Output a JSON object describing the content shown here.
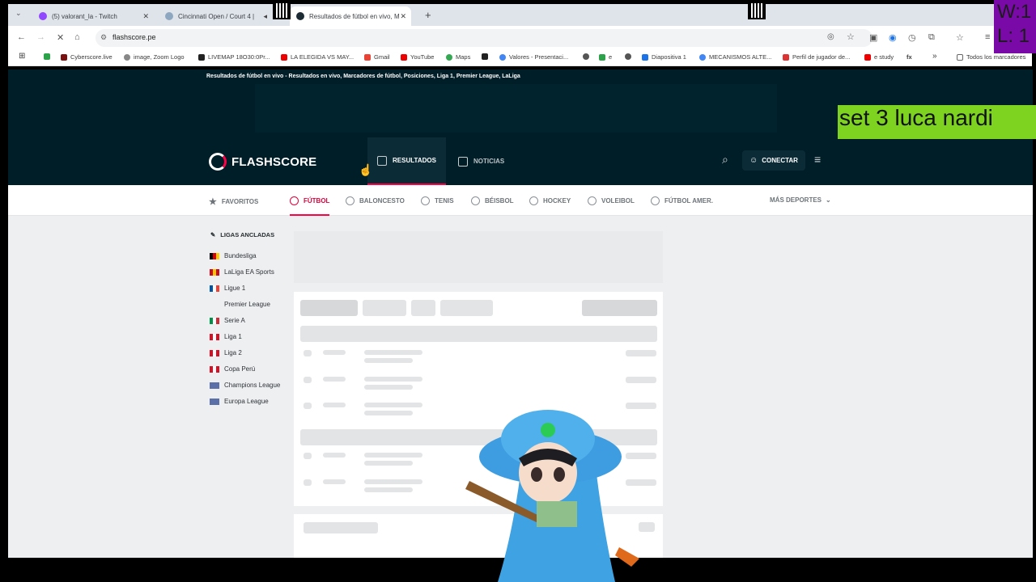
{
  "browser": {
    "tabs": [
      {
        "label": "(5) valorant_la - Twitch",
        "close": "✕"
      },
      {
        "label": "Cincinnati Open / Court 4 |",
        "close": ""
      },
      {
        "label": "Resultados de fútbol en vivo, M",
        "close": "✕"
      }
    ],
    "new_tab": "+",
    "url": "flashscore.pe",
    "bookmarks": [
      "Cyberscore.live",
      "image, Zoom Logo",
      "LIVEMAP 18O30:0Pr...",
      "LA ELEGIDA VS MAY...",
      "Gmail",
      "YouTube",
      "Maps",
      "Valores - Presentaci...",
      "e",
      "Diapositiva 1",
      "MECANISMOS ALTE...",
      "Perfil de jugador de...",
      "e study",
      "Todos los marcadores"
    ],
    "more_bookmarks": "»"
  },
  "site": {
    "top_line": "Resultados de fútbol en vivo - Resultados en vivo, Marcadores de fútbol, Posiciones, Liga 1, Premier League, LaLiga",
    "logo": "FLASHSCORE",
    "nav": {
      "results": "RESULTADOS",
      "news": "NOTICIAS",
      "connect": "CONECTAR"
    },
    "sports": [
      "FAVORITOS",
      "FÚTBOL",
      "BALONCESTO",
      "TENIS",
      "BÉISBOL",
      "HOCKEY",
      "VOLEIBOL",
      "FÚTBOL AMER.",
      "MÁS DEPORTES"
    ],
    "pinned_title": "LIGAS ANCLADAS",
    "leagues": [
      {
        "name": "Bundesliga",
        "flag": [
          "#000000",
          "#dd0000",
          "#ffce00"
        ]
      },
      {
        "name": "LaLiga EA Sports",
        "flag": [
          "#c60b1e",
          "#ffc400",
          "#c60b1e"
        ]
      },
      {
        "name": "Ligue 1",
        "flag": [
          "#0055a4",
          "#ffffff",
          "#ef4135"
        ]
      },
      {
        "name": "Premier League",
        "flag": [
          "#eeeff1",
          "#eeeff1",
          "#eeeff1"
        ]
      },
      {
        "name": "Serie A",
        "flag": [
          "#009246",
          "#ffffff",
          "#ce2b37"
        ]
      },
      {
        "name": "Liga 1",
        "flag": [
          "#d91023",
          "#ffffff",
          "#d91023"
        ]
      },
      {
        "name": "Liga 2",
        "flag": [
          "#d91023",
          "#ffffff",
          "#d91023"
        ]
      },
      {
        "name": "Copa Perú",
        "flag": [
          "#d91023",
          "#ffffff",
          "#d91023"
        ]
      },
      {
        "name": "Champions League",
        "flag": [
          "#5b6fa8",
          "#5b6fa8",
          "#5b6fa8"
        ]
      },
      {
        "name": "Europa League",
        "flag": [
          "#5b6fa8",
          "#5b6fa8",
          "#5b6fa8"
        ]
      }
    ]
  },
  "overlay": {
    "label": "set 3 luca nardi",
    "counter_w": "W:1",
    "counter_l": "L: 1"
  },
  "colors": {
    "brand_dark": "#001e28",
    "accent": "#ff0046",
    "overlay_green": "#7ed320",
    "counter_purple": "#7a0aa8"
  }
}
